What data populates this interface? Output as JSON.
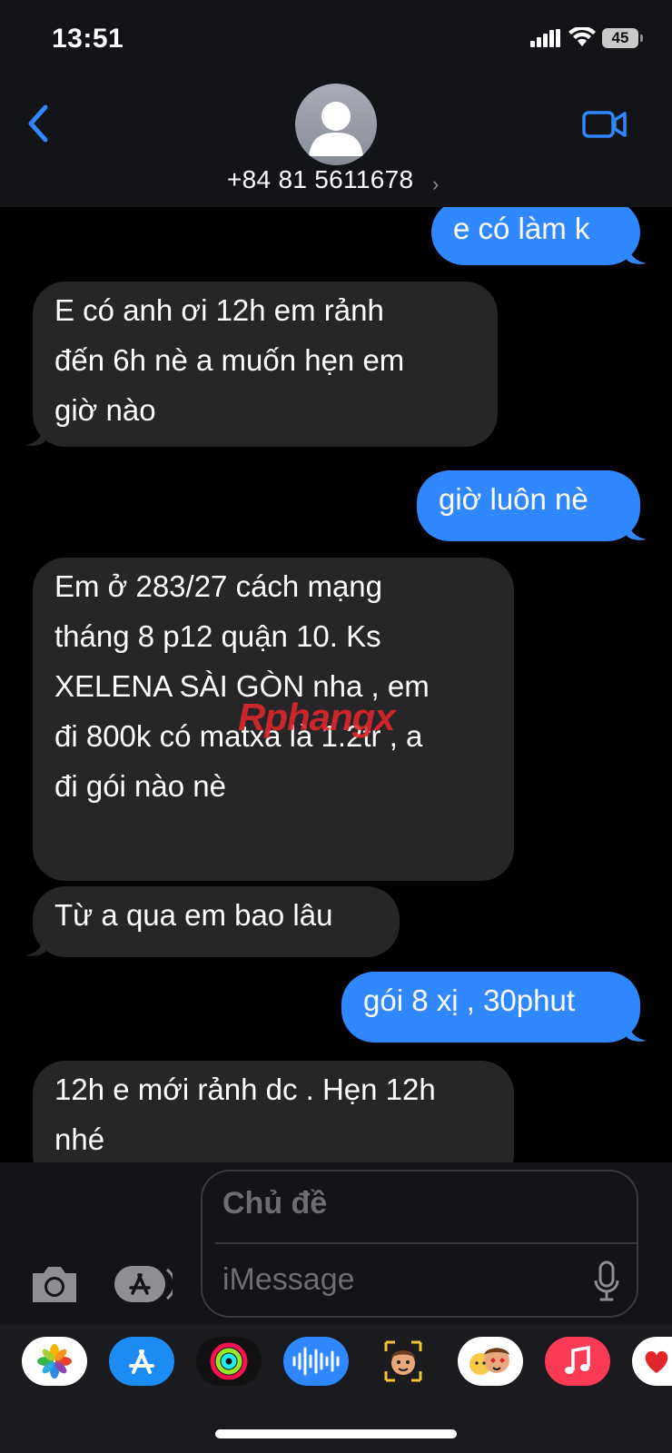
{
  "status_bar": {
    "time": "13:51",
    "battery": "45"
  },
  "header": {
    "contact_name": "+84 81 5611678",
    "chevron": "›"
  },
  "watermark": "Rphangx",
  "messages": [
    {
      "dir": "out",
      "text": "e có làm k"
    },
    {
      "dir": "in",
      "text": "E có anh ơi 12h em rảnh\nđến 6h nè a muốn hẹn em\ngiờ nào"
    },
    {
      "dir": "out",
      "text": "giờ luôn nè"
    },
    {
      "dir": "in",
      "text": "Em ở 283/27 cách mạng\ntháng 8 p12 quận 10. Ks\nXELENA SÀI GÒN nha , em\nđi 800k có matxa là 1.2tr , a\nđi gói nào nè"
    },
    {
      "dir": "in",
      "text": "Từ a qua em bao lâu"
    },
    {
      "dir": "out",
      "text": "gói 8 xị , 30phut"
    },
    {
      "dir": "in",
      "text": "12h e mới rảnh dc . Hẹn 12h\nnhé"
    }
  ],
  "compose": {
    "subject_placeholder": "Chủ đề",
    "message_placeholder": "iMessage"
  },
  "apps": [
    "photos-icon",
    "app-store-icon",
    "fitness-icon",
    "audio-message-icon",
    "memoji-icon",
    "memoji-stickers-icon",
    "music-icon",
    "digital-touch-icon"
  ],
  "colors": {
    "outgoing": "#2f88ff",
    "incoming": "#262629",
    "accent": "#2f88ff"
  }
}
